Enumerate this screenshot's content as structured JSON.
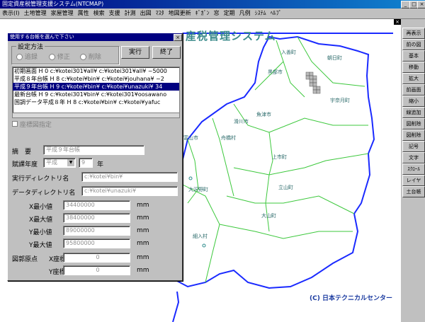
{
  "window": {
    "title": "固定資産税管理支援システム(NTCMAP)"
  },
  "menu": [
    "表示(I)",
    "土地管理",
    "家屋管理",
    "属性",
    "検索",
    "支援",
    "計測",
    "出図",
    "ﾏｽﾀ",
    "地図更新",
    "ｷﾞｶﾞﾝ",
    "窓",
    "定期",
    "凡例",
    "ｼｽﾃﾑ",
    "ﾍﾙﾌﾟ"
  ],
  "map": {
    "title": "産税管理システム",
    "copyright": "(C) 日本テクニカルセンター",
    "places": [
      "入善町",
      "朝日町",
      "黒部市",
      "魚津市",
      "滑川市",
      "宇奈月町",
      "富山市",
      "舟橋村",
      "上市町",
      "立山町",
      "大沢野町",
      "大山町",
      "細入村"
    ]
  },
  "toolbar": [
    "再表示",
    "前の図",
    "基本",
    "移動",
    "拡大",
    "前画面",
    "縮小",
    "線追加",
    "図削除",
    "図削除",
    "記号",
    "文字",
    "ｽｸﾛｰﾙ",
    "レイヤ",
    "土台帳"
  ],
  "dialog": {
    "title": "使用する台帳を選んで下さい",
    "method_label": "設定方法",
    "options": [
      "追録",
      "修正",
      "削除"
    ],
    "run_button": "実行",
    "end_button": "終了",
    "ledgers": [
      "初期画面 H 0 c:¥kotei301¥all¥ c:¥kotei301¥all¥ ~5000",
      "平成８年台帳 H 8 c:¥kotei¥bin¥ c:¥kotei¥jouhana¥ ~2",
      "平成９年台帳 H 9 c:¥kotei¥bin¥ c:¥kotei¥unazuki¥ 34",
      "最新台帳 H 9 c:¥kotei301¥bin¥ c:¥kotei301¥oosawano",
      "国調データ平成８年 H 8 c:¥kotei¥bin¥ c:¥kotei¥yafuc"
    ],
    "selected_index": 2,
    "coord_check": "座標図指定",
    "summary_label": "摘　要",
    "summary_value": "平成９年台帳",
    "year_label": "賦課年度",
    "era_value": "平成",
    "year_value": "9",
    "year_unit": "年",
    "exec_dir_label": "実行ディレクトリ名",
    "exec_dir_value": "c:¥kotei¥bin¥",
    "data_dir_label": "データディレクトリ名",
    "data_dir_value": "c:¥kotei¥unazuki¥",
    "x_min_label": "X最小値",
    "x_min_value": "34400000",
    "x_max_label": "X最大値",
    "x_max_value": "38400000",
    "y_min_label": "Y最小値",
    "y_min_value": "89000000",
    "y_max_label": "Y最大値",
    "y_max_value": "95800000",
    "unit": "mm",
    "origin_label": "図郭原点",
    "x_coord_label": "X座標",
    "x_coord_value": "0",
    "y_coord_label": "Y座標",
    "y_coord_value": "0"
  }
}
